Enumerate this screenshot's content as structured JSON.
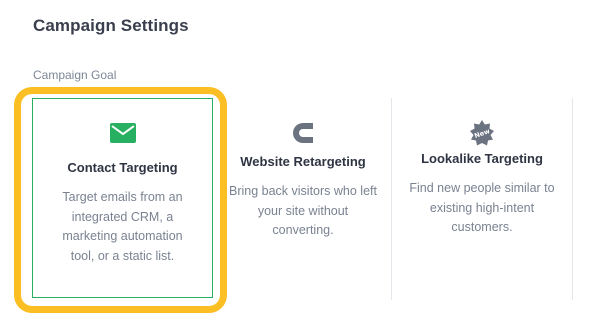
{
  "header": {
    "title": "Campaign Settings"
  },
  "goal": {
    "label": "Campaign Goal"
  },
  "colors": {
    "selected_border": "#27b061",
    "highlight": "#fbbf24",
    "icon_gray": "#6b7280",
    "icon_green": "#27b061"
  },
  "options": [
    {
      "name": "Contact Targeting",
      "description": "Target emails from an integrated CRM, a marketing automation tool, or a static list.",
      "icon": "envelope-icon",
      "selected": true
    },
    {
      "name": "Website Retargeting",
      "description": "Bring back visitors who left your site without converting.",
      "icon": "magnet-icon",
      "selected": false
    },
    {
      "name": "Lookalike Targeting",
      "description": "Find new people similar to existing high-intent customers.",
      "icon": "new-badge-icon",
      "badge_text": "New",
      "selected": false
    }
  ]
}
